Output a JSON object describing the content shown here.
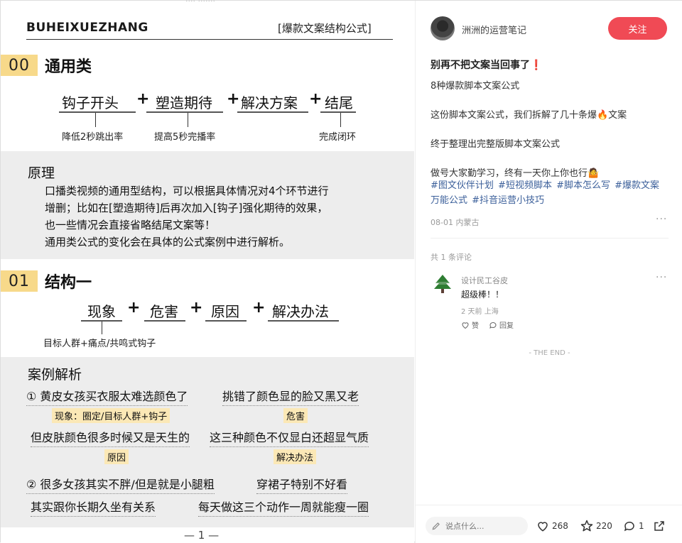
{
  "poster": {
    "top_cut": "···· ·······",
    "brand": "BUHEIXUEZHANG",
    "title": "[爆款文案结构公式]",
    "section0": {
      "num": "00",
      "name": "通用类",
      "terms": [
        "钩子开头",
        "塑造期待",
        "解决方案",
        "结尾"
      ],
      "plus": "+",
      "notes": [
        "降低2秒跳出率",
        "提高5秒完播率",
        "完成闭环"
      ]
    },
    "principle": {
      "title": "原理",
      "lines": [
        "口播类视频的通用型结构，可以根据具体情况对4个环节进行",
        "增删；比如在[塑造期待]后再次加入[钩子]强化期待的效果，",
        "也一些情况会直接省略结尾文案等！",
        "通用类公式的变化会在具体的公式案例中进行解析。"
      ]
    },
    "section1": {
      "num": "01",
      "name": "结构一",
      "terms": [
        "现象",
        "危害",
        "原因",
        "解决办法"
      ],
      "plus": "+",
      "note": "目标人群+痛点/共鸣式钩子"
    },
    "cases": {
      "title": "案例解析",
      "c1_a": "① 黄皮女孩买衣服太难选颜色了",
      "c1_b": "挑错了颜色显的脸又黑又老",
      "c1_tag_a": "现象：圈定/目标人群+钩子",
      "c1_tag_b": "危害",
      "c1_c": "但皮肤颜色很多时候又是天生的",
      "c1_d": "这三种颜色不仅显白还超显气质",
      "c1_tag_c": "原因",
      "c1_tag_d": "解决办法",
      "c2_a": "② 很多女孩其实不胖/但是就是小腿粗",
      "c2_b": "穿裙子特别不好看",
      "c2_c": "其实跟你长期久坐有关系",
      "c2_d": "每天做这三个动作一周就能瘦一圈"
    },
    "page_num": "— 1 —"
  },
  "panel": {
    "author": "洲洲的运营笔记",
    "follow_label": "关注",
    "post_title": "别再不把文案当回事了❗",
    "lines": [
      "8种爆款脚本文案公式",
      "这份脚本文案公式，我们拆解了几十条爆🔥文案",
      "终于整理出完整版脚本文案公式",
      "做号大家勤学习，终有一天你上你也行🤷"
    ],
    "hashtags": [
      "#图文伙伴计划",
      "#短视频脚本",
      "#脚本怎么写",
      "#爆款文案万能公式",
      "#抖音运营小技巧"
    ],
    "meta": "08-01 内蒙古",
    "more": "···",
    "comment_count": "共 1 条评论",
    "comment": {
      "name": "设计民工谷皮",
      "text": "超级棒！！",
      "meta": "2 天前  上海",
      "like_label": "赞",
      "reply_label": "回复"
    },
    "the_end": "- THE END -",
    "comment_placeholder": "说点什么...",
    "stats": {
      "likes": "268",
      "stars": "220",
      "comments": "1"
    }
  }
}
